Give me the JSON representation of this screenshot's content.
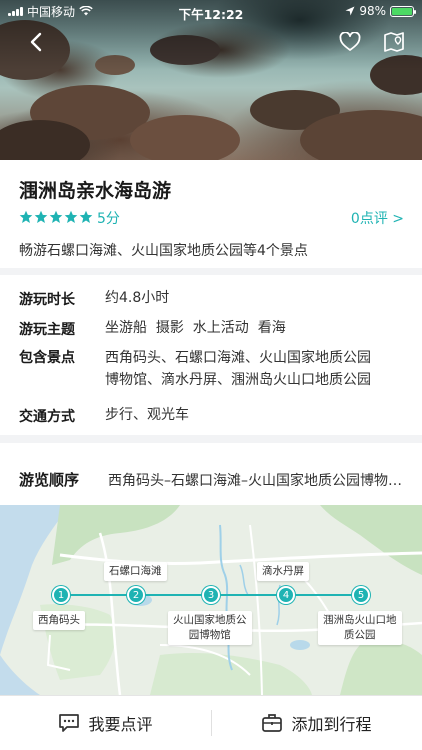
{
  "status_bar": {
    "carrier": "中国移动",
    "time": "下午12:22",
    "battery": "98%",
    "battery_level": 0.98
  },
  "header": {
    "back_icon": "back-chevron-icon",
    "favorite_icon": "heart-outline-icon",
    "map_icon": "map-icon"
  },
  "tour": {
    "title": "涠洲岛亲水海岛游",
    "rating_stars": 5,
    "score": "5分",
    "review_link": "0点评 >",
    "subtitle": "畅游石螺口海滩、火山国家地质公园等4个景点"
  },
  "info": {
    "duration_label": "游玩时长",
    "duration_value": "约4.8小时",
    "theme_label": "游玩主题",
    "theme_value": "坐游船  摄影  水上活动  看海",
    "spots_label": "包含景点",
    "spots_line1": "西角码头、石螺口海滩、火山国家地质公园",
    "spots_line2": "博物馆、滴水丹屏、涠洲岛火山口地质公园",
    "transport_label": "交通方式",
    "transport_value": "步行、观光车"
  },
  "route": {
    "label": "游览顺序",
    "value": "西角码头–石螺口海滩–火山国家地质公园博物馆–滴水丹屏–涠洲岛火山口地质公园",
    "stops": [
      {
        "num": "1",
        "name": "西角码头"
      },
      {
        "num": "2",
        "name": "石螺口海滩"
      },
      {
        "num": "3",
        "name_line1": "火山国家地质公",
        "name_line2": "园博物馆"
      },
      {
        "num": "4",
        "name": "滴水丹屏"
      },
      {
        "num": "5",
        "name_line1": "涠洲岛火山口地",
        "name_line2": "质公园"
      }
    ]
  },
  "bottom_bar": {
    "review_label": "我要点评",
    "add_label": "添加到行程"
  },
  "colors": {
    "accent": "#1fb3b3",
    "star": "#1fb3b3",
    "page_bg": "#f2f3f5"
  }
}
